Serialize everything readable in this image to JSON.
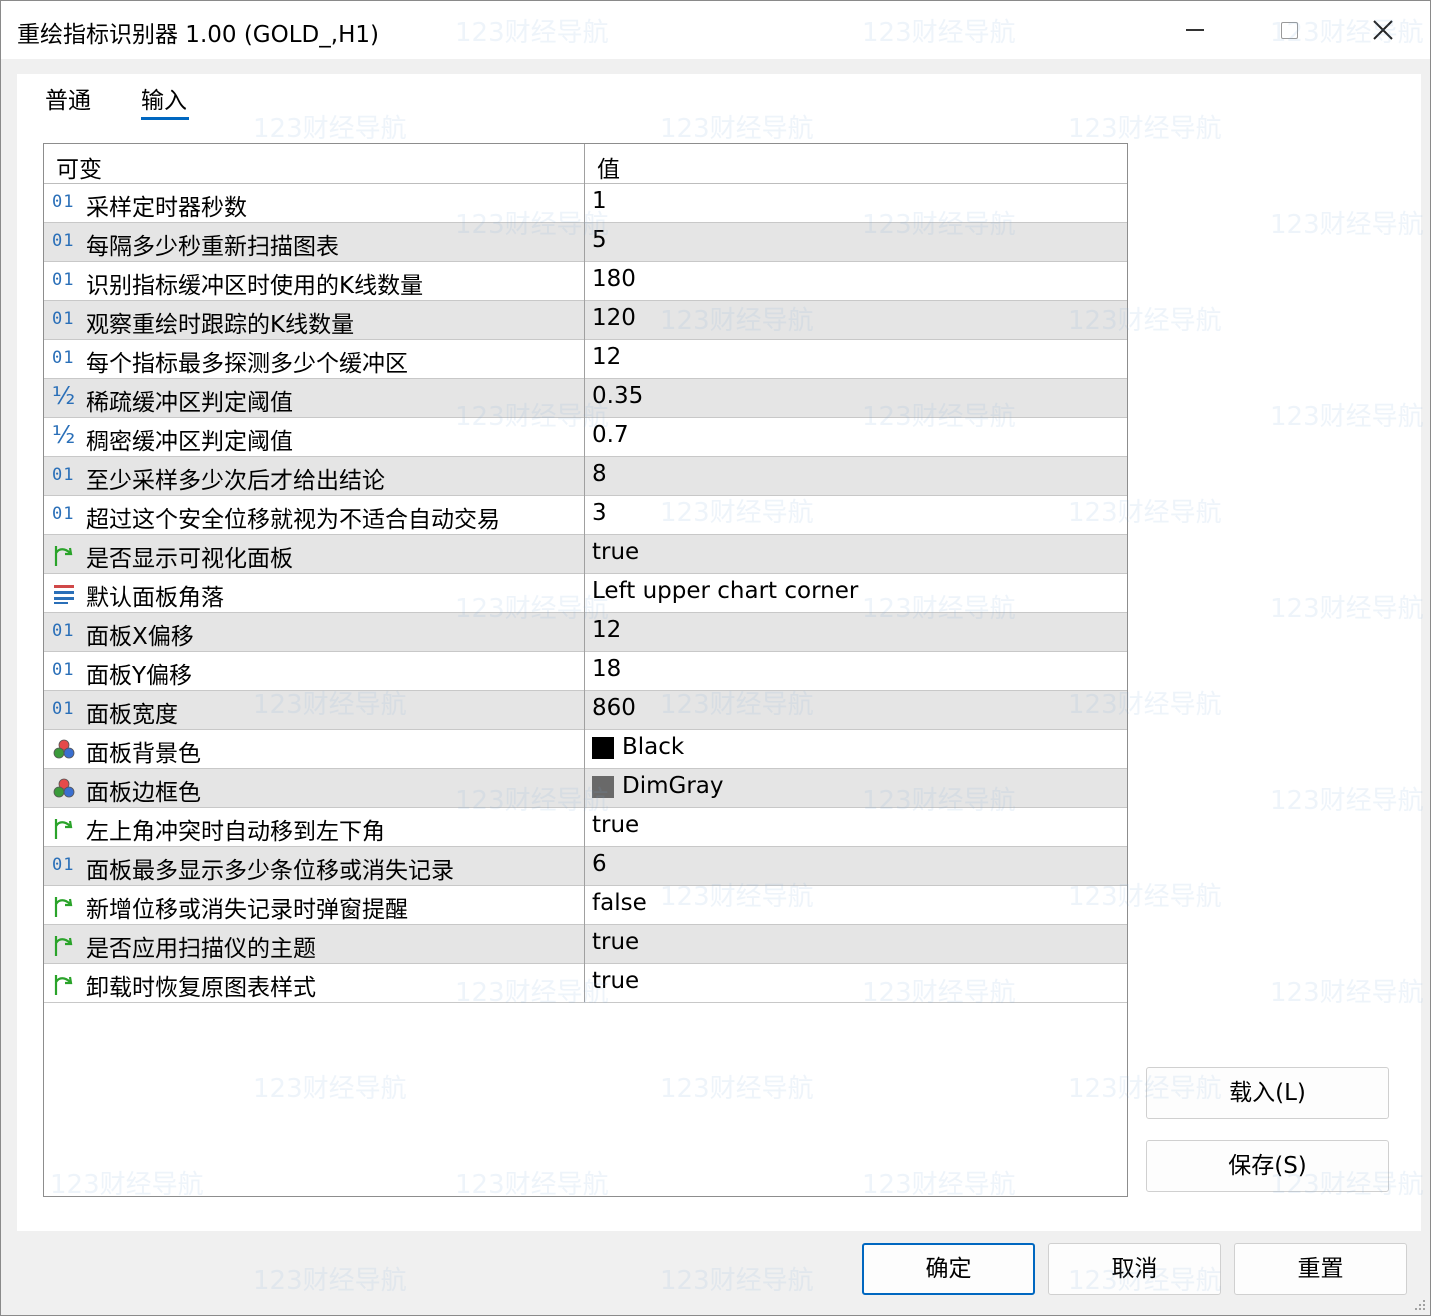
{
  "window": {
    "title": "重绘指标识别器 1.00 (GOLD_,H1)"
  },
  "tabs": [
    {
      "label": "普通",
      "active": false
    },
    {
      "label": "输入",
      "active": true
    }
  ],
  "grid": {
    "header": {
      "col_variable": "可变",
      "col_value": "值"
    },
    "rows": [
      {
        "icon": "integer-icon",
        "name": "采样定时器秒数",
        "value": "1"
      },
      {
        "icon": "integer-icon",
        "name": "每隔多少秒重新扫描图表",
        "value": "5"
      },
      {
        "icon": "integer-icon",
        "name": "识别指标缓冲区时使用的K线数量",
        "value": "180"
      },
      {
        "icon": "integer-icon",
        "name": "观察重绘时跟踪的K线数量",
        "value": "120"
      },
      {
        "icon": "integer-icon",
        "name": "每个指标最多探测多少个缓冲区",
        "value": "12"
      },
      {
        "icon": "fraction-icon",
        "name": "稀疏缓冲区判定阈值",
        "value": "0.35"
      },
      {
        "icon": "fraction-icon",
        "name": "稠密缓冲区判定阈值",
        "value": "0.7"
      },
      {
        "icon": "integer-icon",
        "name": "至少采样多少次后才给出结论",
        "value": "8"
      },
      {
        "icon": "integer-icon",
        "name": "超过这个安全位移就视为不适合自动交易",
        "value": "3"
      },
      {
        "icon": "bool-icon",
        "name": "是否显示可视化面板",
        "value": "true"
      },
      {
        "icon": "enum-icon",
        "name": "默认面板角落",
        "value": "Left upper chart corner"
      },
      {
        "icon": "integer-icon",
        "name": "面板X偏移",
        "value": "12"
      },
      {
        "icon": "integer-icon",
        "name": "面板Y偏移",
        "value": "18"
      },
      {
        "icon": "integer-icon",
        "name": "面板宽度",
        "value": "860"
      },
      {
        "icon": "color-icon",
        "name": "面板背景色",
        "value": "Black",
        "swatch": "#000000"
      },
      {
        "icon": "color-icon",
        "name": "面板边框色",
        "value": "DimGray",
        "swatch": "#696969"
      },
      {
        "icon": "bool-icon",
        "name": "左上角冲突时自动移到左下角",
        "value": "true"
      },
      {
        "icon": "integer-icon",
        "name": "面板最多显示多少条位移或消失记录",
        "value": "6"
      },
      {
        "icon": "bool-icon",
        "name": "新增位移或消失记录时弹窗提醒",
        "value": "false"
      },
      {
        "icon": "bool-icon",
        "name": "是否应用扫描仪的主题",
        "value": "true"
      },
      {
        "icon": "bool-icon",
        "name": "卸载时恢复原图表样式",
        "value": "true"
      }
    ]
  },
  "side_buttons": {
    "load": "载入(L)",
    "save": "保存(S)"
  },
  "footer_buttons": {
    "ok": "确定",
    "cancel": "取消",
    "reset": "重置"
  },
  "watermark_text": "123财经导航",
  "colors": {
    "accent": "#0067c0",
    "int_icon": "#2a6fb8",
    "bool_icon": "#2aa32a",
    "row_alt": "#e5e5e5"
  }
}
